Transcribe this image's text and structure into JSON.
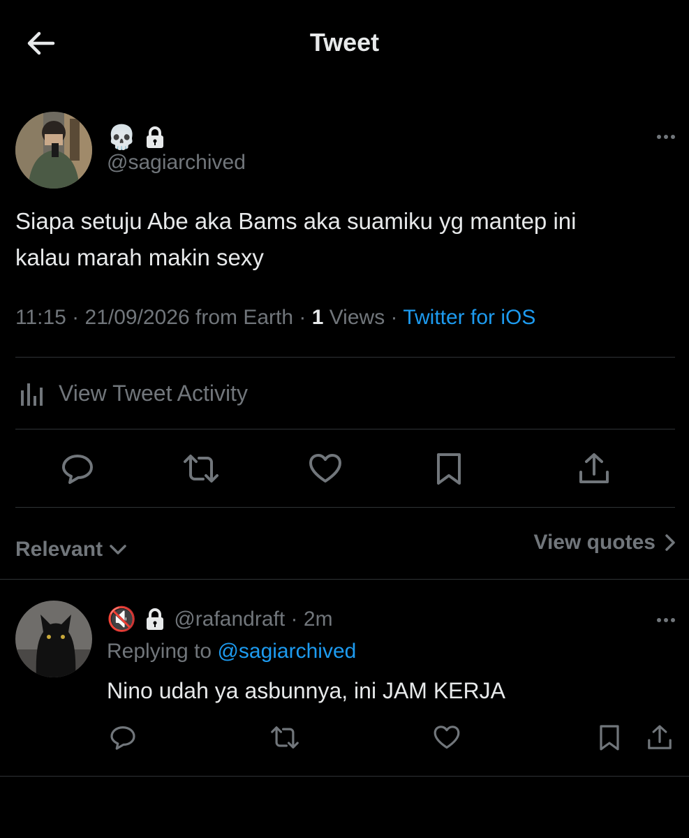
{
  "header": {
    "title": "Tweet"
  },
  "tweet": {
    "name_emoji": "💀",
    "handle": "@sagiarchived",
    "text_line1": "Siapa setuju Abe aka Bams aka suamiku yg mantep ini",
    "text_line2": "kalau marah makin sexy",
    "time_date": "11:15 · 21/09/2026 from Earth · ",
    "views_count": "1",
    "views_label": " Views · ",
    "source": "Twitter for iOS",
    "activity_label": "View Tweet Activity"
  },
  "sort": {
    "label": "Relevant",
    "view_quotes": "View quotes"
  },
  "reply": {
    "name_emoji": "🔇",
    "handle": "@rafandraft",
    "time": " · 2m",
    "replying_prefix": "Replying to ",
    "replying_to": "@sagiarchived",
    "text": "Nino udah ya asbunnya, ini JAM KERJA"
  },
  "colors": {
    "background": "#000000",
    "text": "#e7e9ea",
    "muted": "#71767b",
    "accent": "#1d9bf0",
    "divider": "#2f3336"
  },
  "icons": [
    "back-arrow-icon",
    "lock-icon",
    "more-icon",
    "bar-chart-icon",
    "reply-icon",
    "retweet-icon",
    "like-icon",
    "bookmark-icon",
    "share-icon",
    "chevron-down-icon",
    "chevron-right-icon"
  ]
}
